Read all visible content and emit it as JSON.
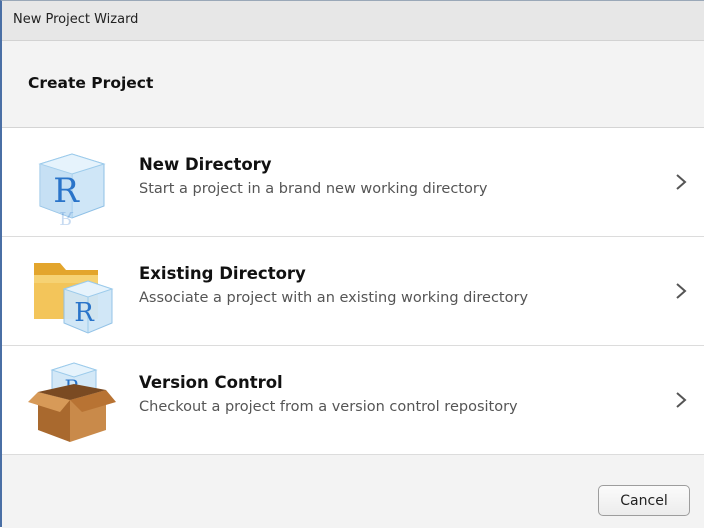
{
  "window": {
    "title": "New Project Wizard"
  },
  "header": {
    "title": "Create Project"
  },
  "options": [
    {
      "title": "New Directory",
      "description": "Start a project in a brand new working directory",
      "icon": "r-cube-icon"
    },
    {
      "title": "Existing Directory",
      "description": "Associate a project with an existing working directory",
      "icon": "folder-r-cube-icon"
    },
    {
      "title": "Version Control",
      "description": "Checkout a project from a version control repository",
      "icon": "box-r-cube-icon"
    }
  ],
  "footer": {
    "cancel_label": "Cancel"
  },
  "colors": {
    "r_blue": "#2a74c9",
    "cube_fill": "#cfe6f7",
    "folder": "#f0b53c",
    "box": "#b87333"
  }
}
